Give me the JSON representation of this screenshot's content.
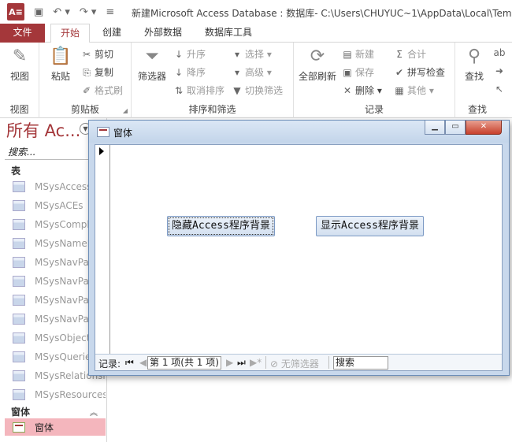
{
  "window": {
    "app_logo": "A≡",
    "title": "新建Microsoft Access Database : 数据库- C:\\Users\\CHUYUC~1\\AppData\\Local\\Temp"
  },
  "ribbon_tabs": [
    "文件",
    "开始",
    "创建",
    "外部数据",
    "数据库工具"
  ],
  "ribbon": {
    "view": {
      "label": "视图",
      "group": "视图"
    },
    "clipboard": {
      "paste": "粘贴",
      "cut": "剪切",
      "copy": "复制",
      "format_painter": "格式刷",
      "group": "剪贴板"
    },
    "sort_filter": {
      "filter": "筛选器",
      "ascending": "升序",
      "descending": "降序",
      "remove_sort": "取消排序",
      "selection": "选择",
      "advanced": "高级",
      "toggle_filter": "切换筛选",
      "group": "排序和筛选"
    },
    "records": {
      "refresh_all": "全部刷新",
      "new": "新建",
      "save": "保存",
      "delete": "删除",
      "totals": "合计",
      "spelling": "拼写检查",
      "more": "其他",
      "group": "记录"
    },
    "find": {
      "find": "查找",
      "group": "查找"
    }
  },
  "nav_pane": {
    "title": "所有 Ac...",
    "search_placeholder": "搜索...",
    "tables_header": "表",
    "tables": [
      "MSysAccessStorage",
      "MSysACEs",
      "MSysComplexColumns",
      "MSysNameMap",
      "MSysNavPaneGroupCategories",
      "MSysNavPaneGroups",
      "MSysNavPaneGroupToObjects",
      "MSysNavPaneObjectIDs",
      "MSysObjects",
      "MSysQueries",
      "MSysRelationships",
      "MSysResources"
    ],
    "forms_header": "窗体",
    "forms": [
      "窗体"
    ]
  },
  "form_window": {
    "title": "窗体",
    "btn_hide": "隐藏Access程序背景",
    "btn_show": "显示Access程序背景",
    "record_nav": {
      "label": "记录:",
      "position": "第 1 项(共 1 项)",
      "no_filter": "无筛选器",
      "search": "搜索"
    }
  }
}
